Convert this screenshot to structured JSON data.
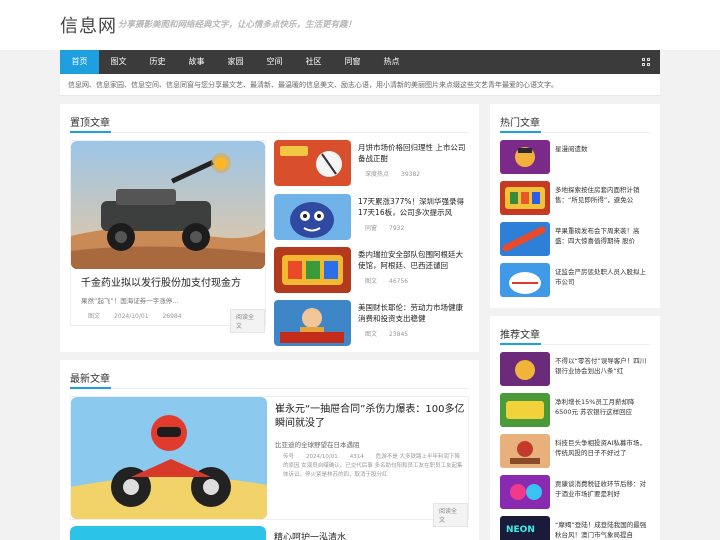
{
  "header": {
    "logo": "信息网",
    "slogan": "分享摄影美图和网络经典文字，让心情多点快乐，生活更有趣！"
  },
  "nav": {
    "items": [
      "首页",
      "图文",
      "历史",
      "故事",
      "家园",
      "空间",
      "社区",
      "同窗",
      "热点"
    ],
    "active_index": 0
  },
  "notice": "信息网、信息家园、信息空间、信息同窗与您分享最文艺、最清新、最温暖的信息美文、励志心语，用小清新的美丽图片来点缀这些文艺青年最爱的心语文字。",
  "top_section": {
    "title": "置顶文章",
    "feature": {
      "title": "千金药业拟以发行股份加支付现金方",
      "excerpt": "果然“起飞”！国海证券一字涨停...",
      "category": "图文",
      "date": "2024/10/01",
      "views": "26984",
      "readmore": "阅读全文"
    },
    "items": [
      {
        "title": "月饼市场价格回归理性 上市公司备战正酣",
        "category": "深度热点",
        "views": "39382"
      },
      {
        "title": "17天累涨377%！深圳华强录得17天16板，公司多次提示风",
        "category": "同窗",
        "views": "7932"
      },
      {
        "title": "委内瑞拉安全部队包围阿根廷大使馆，阿根廷、巴西还谴回",
        "category": "图文",
        "views": "46756"
      },
      {
        "title": "美国财长耶伦：劳动力市场健康 消费和投资支出稳健",
        "category": "图文",
        "views": "23845"
      }
    ]
  },
  "latest_section": {
    "title": "最新文章",
    "feature": {
      "title": "崔永元“一抽屉合同”杀伤力爆表：100多亿瞬间就没了",
      "subtitle": "比亚迪的全球野望在日本遇阻",
      "category": "传号",
      "date": "2024/10/01",
      "views": "4314",
      "excerpt": "危游不是 大多铁路上半年利润下降的原因 女演员自曝确认。已交代后事 多名助句阳和员工友在职员工友起集体诉讼。停火紧是林苏的四，取消于股分红",
      "readmore": "阅读全文"
    },
    "next_title": "精心呵护一泓清水"
  },
  "hot_section": {
    "title": "热门文章",
    "items": [
      "星漫阅遗数",
      "多地探索按住房套内面积计销售：“所见即所得”，避免公",
      "苹果重磅发布会下周来袭！高盛：四大惊喜值得期待 股价",
      "证监会严厉惩处职人员入股拟上市公司"
    ]
  },
  "recommend_section": {
    "title": "推荐文章",
    "items": [
      "不得以“零答付”误导客户！四川银行业协会划出八条“红",
      "净利增长15%员工月薪却降6500元 苏农银行这样回应",
      "科技巨头争相投资AI私募市场，传统风投的日子不好过了",
      "贾康谈消费税征收环节后移：对于酒业市场扩要是利好",
      "“摩羯”登陆！成登陆我国的最强秋台风！澳门市气象局提自"
    ]
  }
}
